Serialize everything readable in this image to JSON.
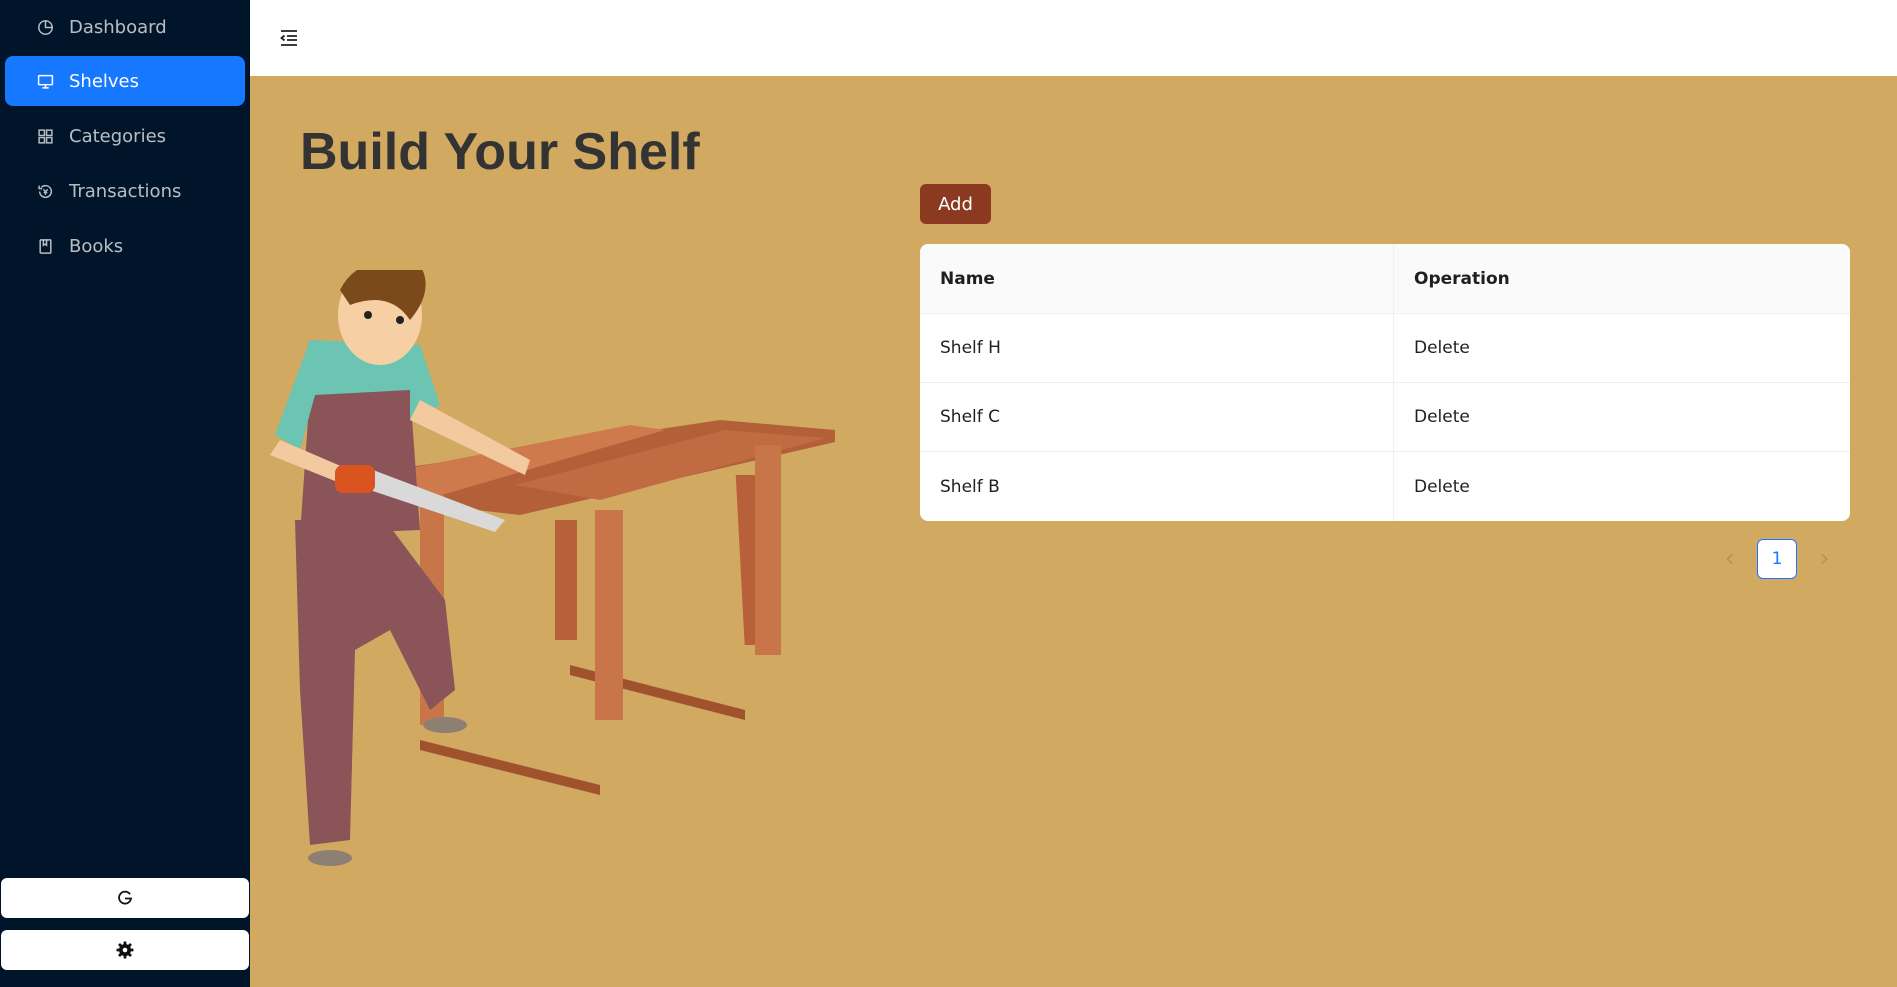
{
  "sidebar": {
    "items": [
      {
        "label": "Dashboard",
        "icon": "pie-chart-icon",
        "active": false
      },
      {
        "label": "Shelves",
        "icon": "desktop-icon",
        "active": true
      },
      {
        "label": "Categories",
        "icon": "appstore-icon",
        "active": false
      },
      {
        "label": "Transactions",
        "icon": "transaction-icon",
        "active": false
      },
      {
        "label": "Books",
        "icon": "book-icon",
        "active": false
      }
    ],
    "bottom_buttons": [
      {
        "icon": "google-icon"
      },
      {
        "icon": "gear-icon"
      }
    ]
  },
  "header": {
    "menu_icon": "menu-fold-icon"
  },
  "main": {
    "title": "Build Your Shelf",
    "add_label": "Add",
    "table": {
      "columns": [
        "Name",
        "Operation"
      ],
      "rows": [
        {
          "name": "Shelf H",
          "operation": "Delete"
        },
        {
          "name": "Shelf C",
          "operation": "Delete"
        },
        {
          "name": "Shelf B",
          "operation": "Delete"
        }
      ]
    },
    "pagination": {
      "current_page": "1",
      "prev_icon": "chevron-left-icon",
      "next_icon": "chevron-right-icon"
    }
  },
  "colors": {
    "sidebar_bg": "#001529",
    "active_item": "#1677ff",
    "page_bg": "#d2a960",
    "add_button": "#8b3a21"
  }
}
